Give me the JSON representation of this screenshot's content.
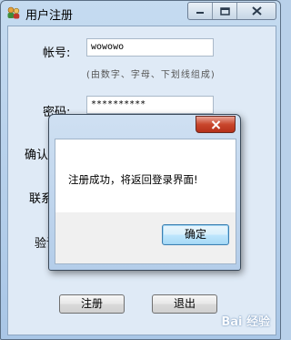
{
  "window": {
    "title": "用户注册",
    "icon": "users-icon",
    "controls": [
      "minimize-icon",
      "maximize-icon",
      "close-icon"
    ]
  },
  "form": {
    "account_label": "帐号:",
    "account_value": "wowowo",
    "account_hint": "(由数字、字母、下划线组成)",
    "password_label": "密码:",
    "password_value": "**********",
    "confirm_label": "确认密码:",
    "contact_label": "联系方式:",
    "captcha_label": "验证码:"
  },
  "buttons": {
    "register": "注册",
    "exit": "退出"
  },
  "dialog": {
    "message": "注册成功，将返回登录界面!",
    "ok": "确定",
    "close_icon": "close-icon"
  },
  "watermark": "Bai 经验"
}
